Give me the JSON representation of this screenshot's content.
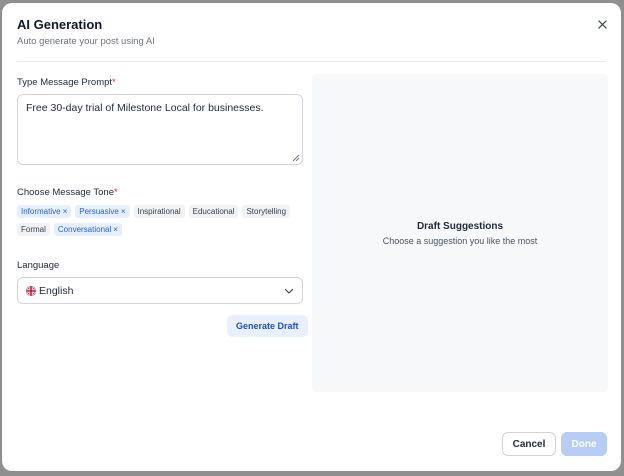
{
  "modal": {
    "title": "AI Generation",
    "subtitle": "Auto generate your post using AI",
    "close_icon": "close-icon"
  },
  "prompt": {
    "label": "Type Message Prompt",
    "required_mark": "*",
    "value": "Free 30-day trial of Milestone Local for businesses."
  },
  "tone": {
    "label": "Choose Message Tone",
    "required_mark": "*",
    "chips": [
      {
        "label": "Informative",
        "selected": true,
        "remove": "×"
      },
      {
        "label": "Persuasive",
        "selected": true,
        "remove": "×"
      },
      {
        "label": "Inspirational",
        "selected": false
      },
      {
        "label": "Educational",
        "selected": false
      },
      {
        "label": "Storytelling",
        "selected": false
      },
      {
        "label": "Formal",
        "selected": false
      },
      {
        "label": "Conversational",
        "selected": true,
        "remove": "×"
      }
    ]
  },
  "language": {
    "label": "Language",
    "selected": "English",
    "flag_icon": "uk-flag-icon",
    "dropdown_icon": "chevron-down-icon"
  },
  "generate_button": "Generate Draft",
  "draft": {
    "title": "Draft Suggestions",
    "subtitle": "Choose a suggestion you like the most"
  },
  "footer": {
    "cancel": "Cancel",
    "done": "Done"
  },
  "colors": {
    "accent": "#2563eb",
    "chip_selected_bg": "#e6efff",
    "done_disabled": "#b8cdf5",
    "required": "#e11d48"
  }
}
